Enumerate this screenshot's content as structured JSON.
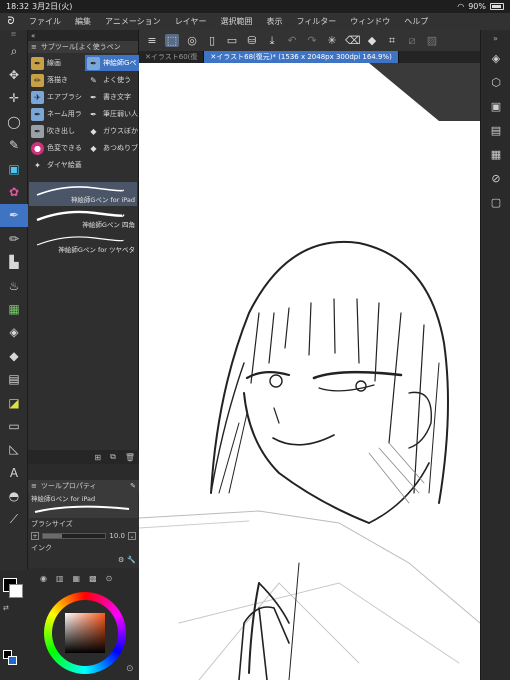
{
  "status": {
    "time": "18:32",
    "date": "3月2日(火)",
    "battery": "90%"
  },
  "menu": [
    "ファイル",
    "編集",
    "アニメーション",
    "レイヤー",
    "選択範囲",
    "表示",
    "フィルター",
    "ウィンドウ",
    "ヘルプ"
  ],
  "tools": [
    "zoom",
    "move",
    "transform",
    "lasso",
    "eyedropper",
    "operation",
    "decoration",
    "pen",
    "pencil",
    "brush",
    "airbrush",
    "blend",
    "fill",
    "eraser",
    "gradient",
    "figure",
    "frame",
    "ruler",
    "text",
    "balloon",
    "line-correction"
  ],
  "subtool": {
    "header": "サブツール[よく使うペン",
    "items": [
      {
        "label": "線画",
        "icon": "pen-icon"
      },
      {
        "label": "神絵師Gペ",
        "icon": "pen-icon",
        "selected": true
      },
      {
        "label": "落描き",
        "icon": "pencil-icon"
      },
      {
        "label": "よく使う",
        "icon": "brush-icon"
      },
      {
        "label": "エアブラシ",
        "icon": "airbrush-icon"
      },
      {
        "label": "書き文字",
        "icon": "pen-icon"
      },
      {
        "label": "ネーム用ラ",
        "icon": "pen-icon"
      },
      {
        "label": "筆圧弱い人",
        "icon": "pen-icon"
      },
      {
        "label": "吹き出し",
        "icon": "pen-icon"
      },
      {
        "label": "ガウスぼか",
        "icon": "blur-icon"
      },
      {
        "label": "色変できる",
        "icon": "circle-icon"
      },
      {
        "label": "あつぬりブ",
        "icon": "brush-icon"
      },
      {
        "label": "ダイヤ絵蓋",
        "icon": "sparkle-icon"
      }
    ],
    "brushes": [
      {
        "label": "神絵師Gペン for iPad",
        "selected": true
      },
      {
        "label": "神絵師Gペン 四角"
      },
      {
        "label": "神絵師Gペン for ツヤベタ"
      }
    ]
  },
  "toolprop": {
    "header": "ツールプロパティ",
    "preview_label": "神絵師Gペン for iPad",
    "brush_size_label": "ブラシサイズ",
    "brush_size_value": "10.0",
    "brush_size_fraction": 0.3,
    "ink_label": "インク"
  },
  "canvas": {
    "tabs": [
      "イラスト60(復",
      "イラスト68(復元)* (1536 x 2048px 300dpi 164.9%)"
    ]
  },
  "colors": {
    "accent": "#3f74c4",
    "foreground": "#000000",
    "background": "#ffffff"
  }
}
